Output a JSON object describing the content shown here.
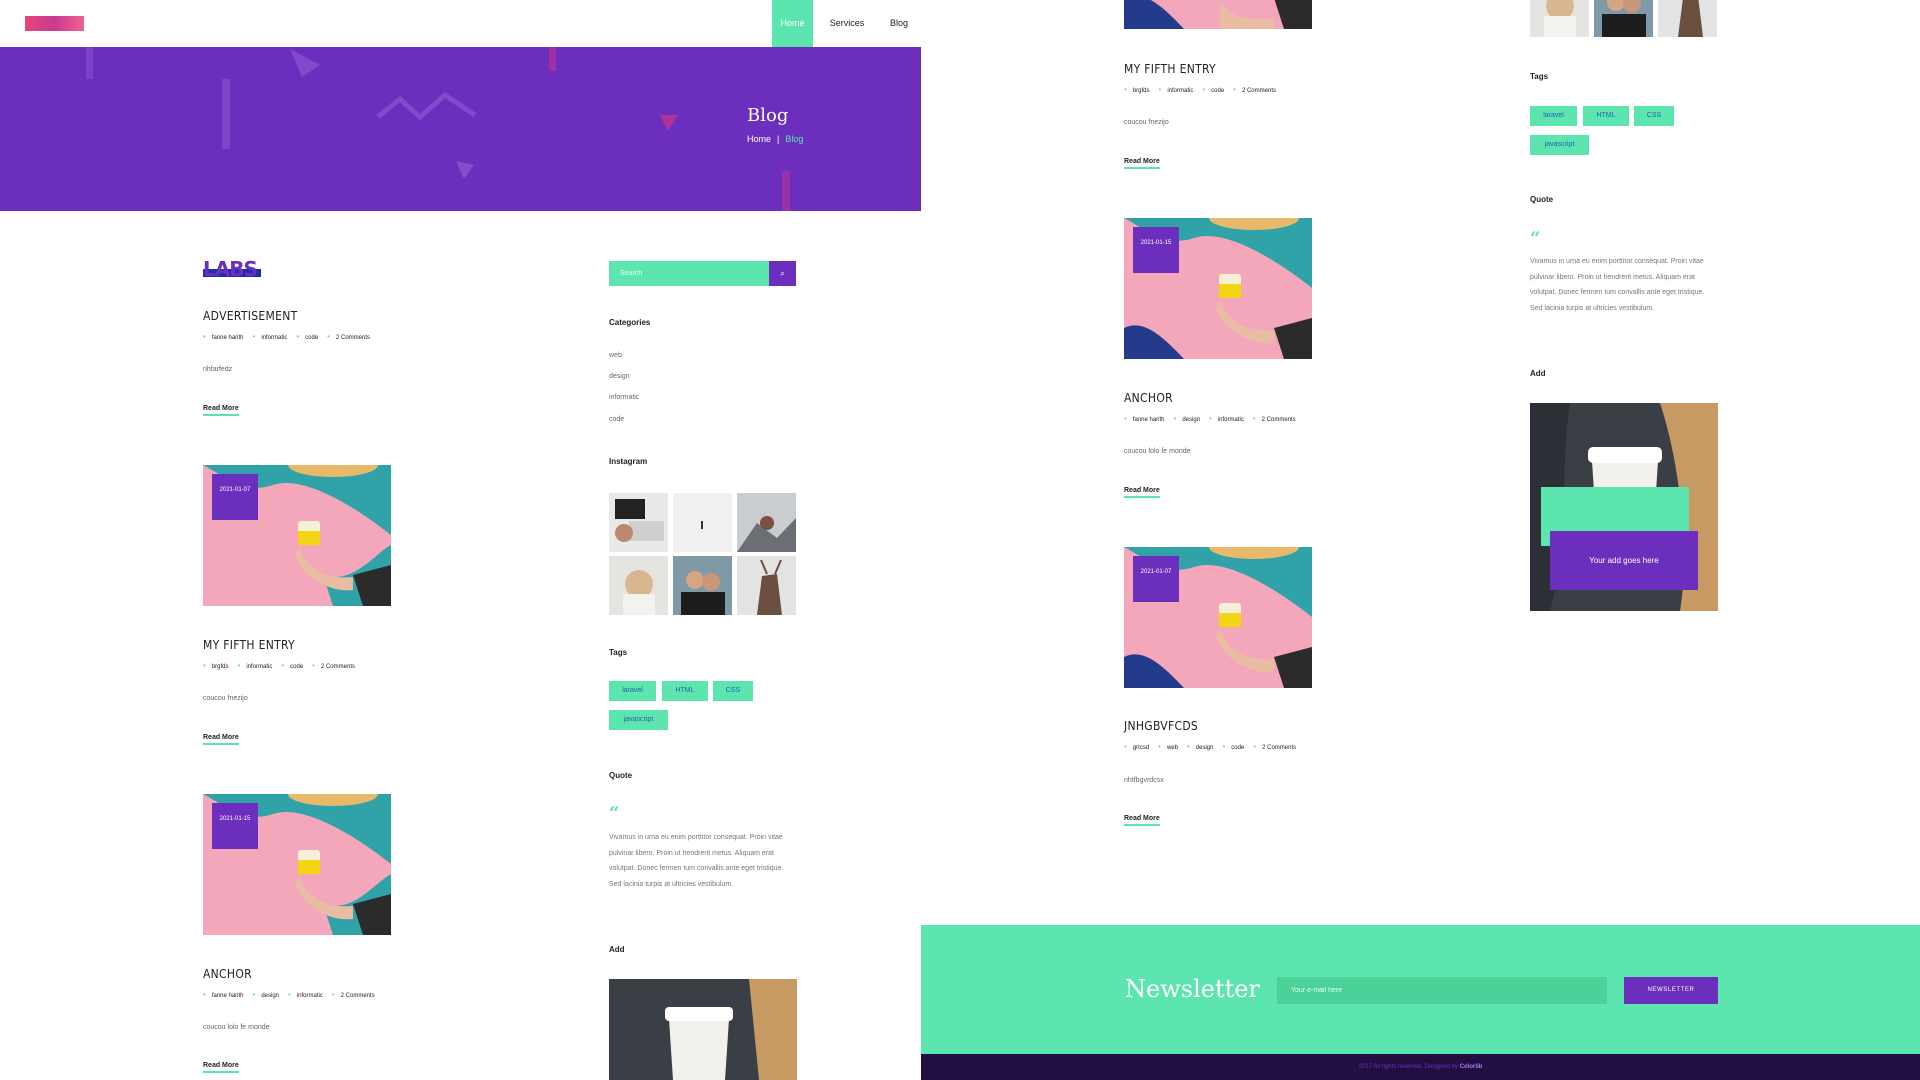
{
  "nav": {
    "items": [
      {
        "label": "Home",
        "active": true
      },
      {
        "label": "Services",
        "active": false
      },
      {
        "label": "Blog",
        "active": false
      }
    ]
  },
  "hero": {
    "title": "Blog",
    "breadcrumb": {
      "home": "Home",
      "separator": "|",
      "current": "Blog"
    }
  },
  "brand": {
    "text": "LABS"
  },
  "posts": [
    {
      "title": "ADVERTISEMENT",
      "meta": [
        "fanne harith",
        "informatic",
        "code",
        "2 Comments"
      ],
      "excerpt": "nhfarfedz",
      "read_more": "Read More",
      "has_image": false
    },
    {
      "title": "MY FIFTH ENTRY",
      "meta": [
        "brgfds",
        "informatic",
        "code",
        "2 Comments"
      ],
      "excerpt": "coucou fnezijo",
      "read_more": "Read More",
      "date": "2021-01-07",
      "has_image": true
    },
    {
      "title": "ANCHOR",
      "meta": [
        "fanne harith",
        "design",
        "informatic",
        "2 Comments"
      ],
      "excerpt": "coucou lolo fe monde",
      "read_more": "Read More",
      "date": "2021-01-15",
      "has_image": true
    },
    {
      "title": "JNHGBVFCDS",
      "meta": [
        "grtcsd",
        "web",
        "design",
        "code",
        "2 Comments"
      ],
      "excerpt": "nhtfbgvrdcsx",
      "read_more": "Read More",
      "date": "2021-01-07",
      "has_image": true
    }
  ],
  "sidebar": {
    "search_placeholder": "Search",
    "categories_title": "Categories",
    "categories": [
      "web",
      "design",
      "informatic",
      "code"
    ],
    "instagram_title": "Instagram",
    "tags_title": "Tags",
    "tags": [
      "laravel",
      "HTML",
      "CSS",
      "javascript"
    ],
    "quote_title": "Quote",
    "quote_mark": "“",
    "quote_text": "Vivamus in urna eu enim porttitor consequat. Proin vitae pulvinar libero. Proin ut hendrerit metus. Aliquam erat volutpat. Donec fermen tum convallis ante eget tristique. Sed lacinia turpis at ultricies vestibulum.",
    "add_title": "Add",
    "ad_text": "Your add goes here"
  },
  "newsletter": {
    "title": "Newsletter",
    "placeholder": "Your e-mail here",
    "button": "NEWSLETTER"
  },
  "footer": {
    "text": "2017 All rights reserved. Designed by ",
    "brand": "Colorlib"
  },
  "colors": {
    "purple": "#6c2fbd",
    "mint": "#5ce5ae",
    "dark": "#200f40"
  }
}
